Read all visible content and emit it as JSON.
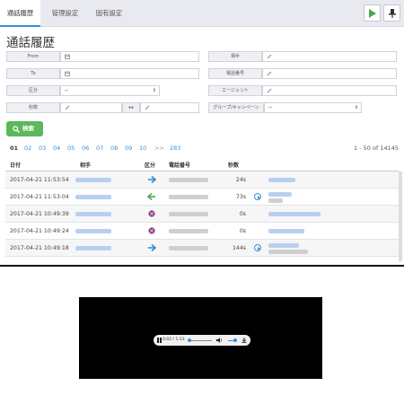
{
  "tabs": [
    {
      "label": "通話履歴",
      "active": true
    },
    {
      "label": "管理設定",
      "active": false
    },
    {
      "label": "固有設定",
      "active": false
    }
  ],
  "toolbar": {
    "play_icon": "play-icon",
    "pin_icon": "pin-icon"
  },
  "page_title": "通話履歴",
  "form": {
    "from_label": "From",
    "to_label": "To",
    "type_label": "区分",
    "type_value": "--",
    "seconds_label": "秒数",
    "party_label": "相手",
    "phone_label": "電話番号",
    "agent_label": "エージェント",
    "group_label": "グループ/キャンペーン",
    "group_value": "--",
    "range_separator": "↔",
    "search_label": "検索"
  },
  "pagination": {
    "pages": [
      "01",
      "02",
      "03",
      "04",
      "05",
      "06",
      "07",
      "08",
      "09",
      "10",
      ">>",
      "283"
    ],
    "current": "01",
    "range_text": "1 - 50 of 14145"
  },
  "table": {
    "columns": [
      "日付",
      "相手",
      "区分",
      "電話番号",
      "秒数"
    ],
    "rows": [
      {
        "date": "2017-04-21 11:53:54",
        "type": "outgoing",
        "seconds": "24s",
        "has_recording": false
      },
      {
        "date": "2017-04-21 11:53:04",
        "type": "incoming",
        "seconds": "73s",
        "has_recording": true
      },
      {
        "date": "2017-04-21 10:49:39",
        "type": "missed",
        "seconds": "0s",
        "has_recording": false
      },
      {
        "date": "2017-04-21 10:49:24",
        "type": "missed",
        "seconds": "0s",
        "has_recording": false
      },
      {
        "date": "2017-04-21 10:49:18",
        "type": "outgoing",
        "seconds": "144s",
        "has_recording": true
      }
    ]
  },
  "player": {
    "time": "0:02 / 1:13",
    "progress": 0.03,
    "volume": 0.8
  },
  "colors": {
    "accent": "#3b8ed8",
    "success": "#5cb85c",
    "outgoing": "#2d8fd5",
    "incoming": "#4aa84a"
  }
}
